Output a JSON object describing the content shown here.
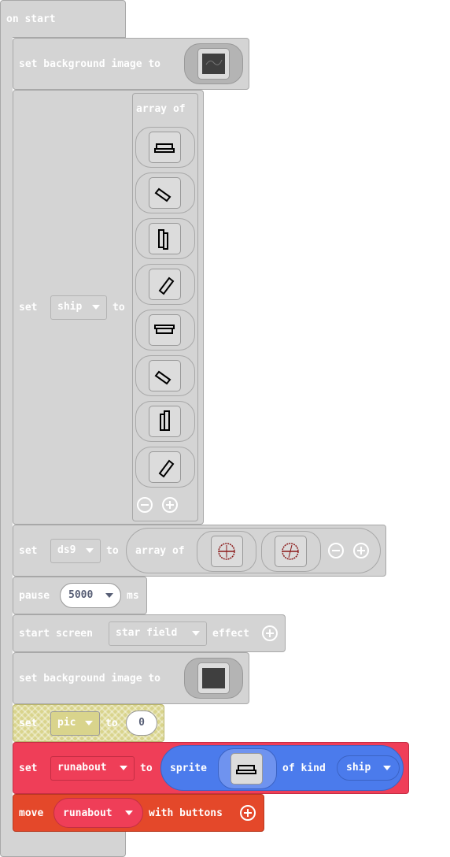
{
  "blocks": {
    "on_start": {
      "label": "on start"
    },
    "bg1": {
      "label": "set background image to"
    },
    "set_ship": {
      "set": "set",
      "var": "ship",
      "to": "to",
      "array_of": "array of"
    },
    "set_ds9": {
      "set": "set",
      "var": "ds9",
      "to": "to",
      "array_of": "array of"
    },
    "pause": {
      "label": "pause",
      "value": "5000",
      "unit": "ms"
    },
    "screen_effect": {
      "label": "start screen",
      "effect": "star field",
      "suffix": "effect"
    },
    "bg2": {
      "label": "set background image to"
    },
    "set_pic": {
      "set": "set",
      "var": "pic",
      "to": "to",
      "value": "0"
    },
    "set_runabout": {
      "set": "set",
      "var": "runabout",
      "to": "to",
      "sprite": "sprite",
      "of_kind": "of kind",
      "kind": "ship"
    },
    "move": {
      "label": "move",
      "var": "runabout",
      "suffix": "with buttons"
    }
  },
  "colors": {
    "block_gray": "#d4d4d4",
    "variables": "#ef3e58",
    "sprites": "#4b7bec",
    "controller": "#e4482a",
    "pic_block": "#d9d48c"
  }
}
